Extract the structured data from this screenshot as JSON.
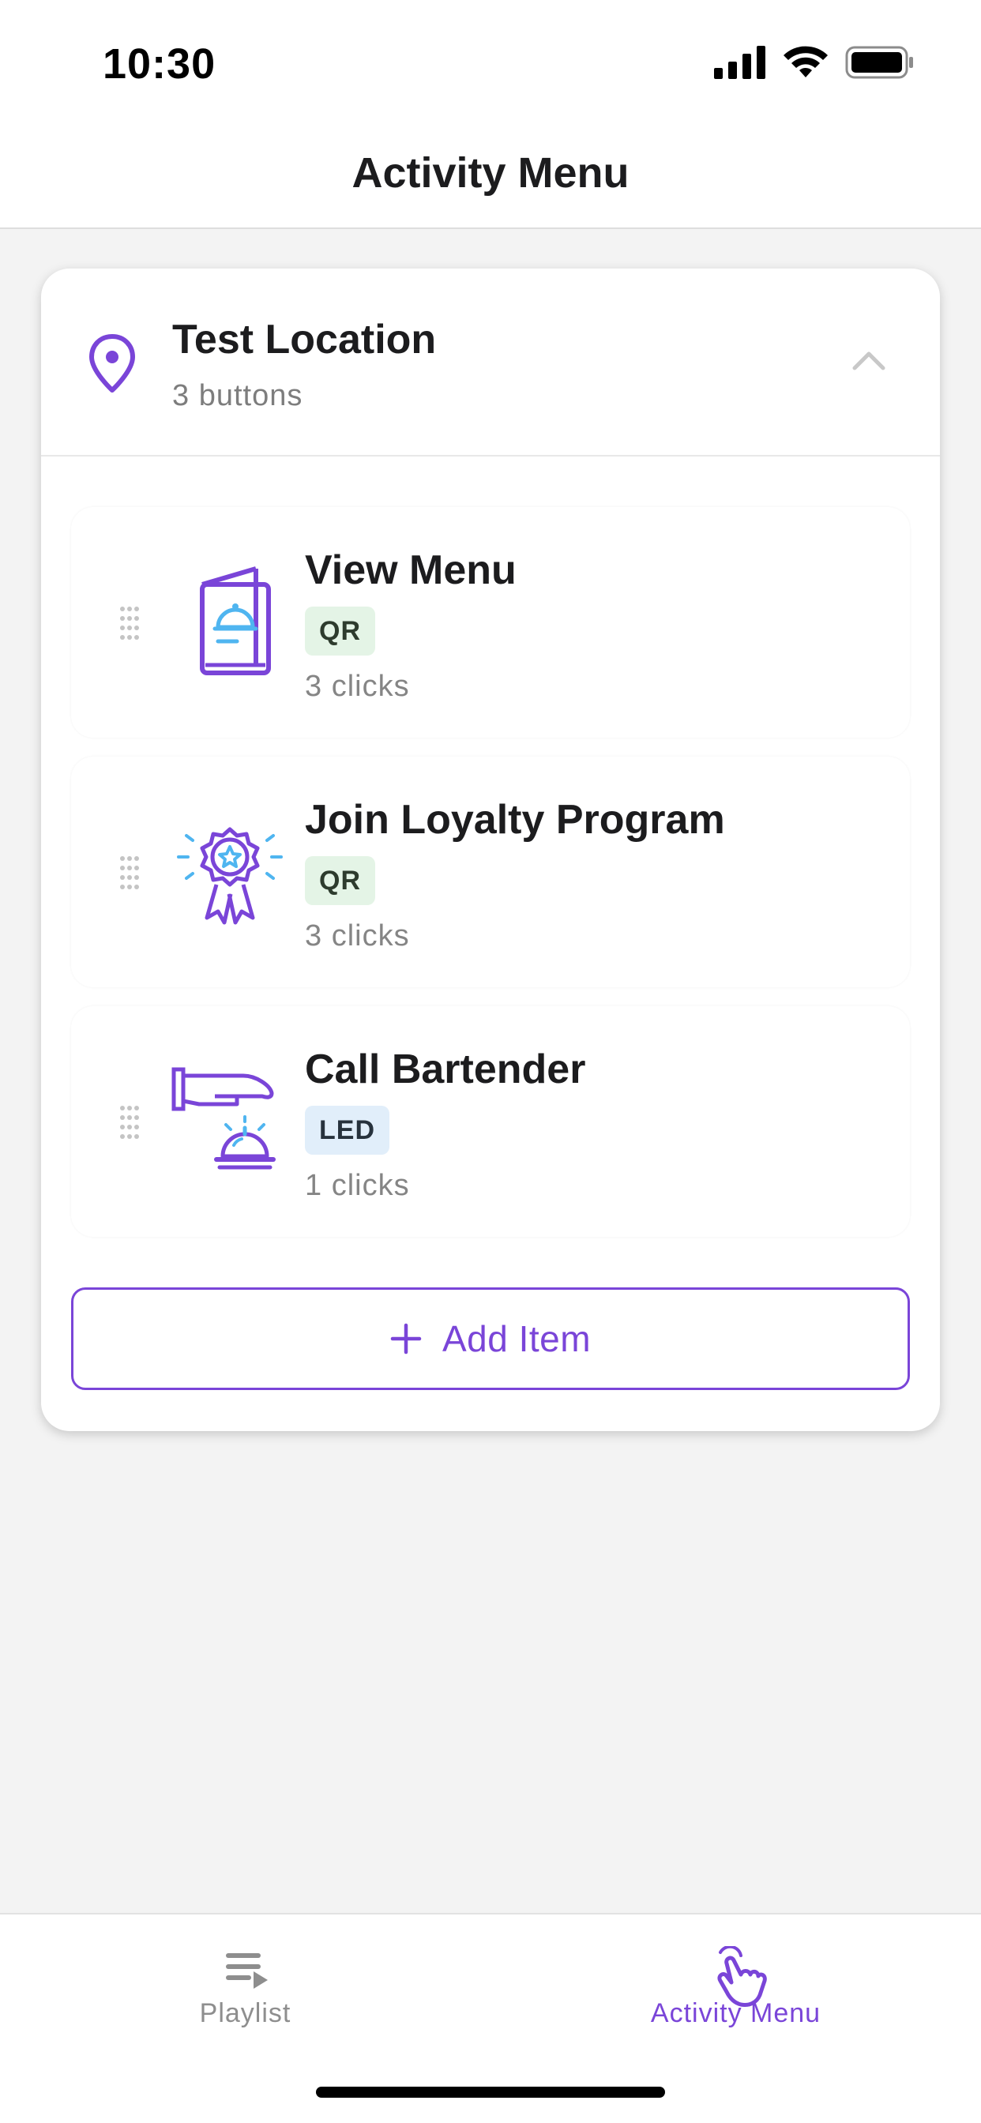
{
  "status_bar": {
    "time": "10:30"
  },
  "header": {
    "title": "Activity Menu"
  },
  "location": {
    "name": "Test Location",
    "subtitle": "3 buttons",
    "expanded": true
  },
  "items": [
    {
      "title": "View Menu",
      "badge": "QR",
      "clicks": "3 clicks",
      "icon": "menu-book-icon"
    },
    {
      "title": "Join Loyalty Program",
      "badge": "QR",
      "clicks": "3 clicks",
      "icon": "award-badge-icon"
    },
    {
      "title": "Call Bartender",
      "badge": "LED",
      "clicks": "1 clicks",
      "icon": "service-bell-icon"
    }
  ],
  "add_item": {
    "label": "Add Item"
  },
  "tab_bar": {
    "tabs": [
      {
        "label": "Playlist",
        "icon": "playlist-icon",
        "active": false
      },
      {
        "label": "Activity Menu",
        "icon": "tap-hand-icon",
        "active": true
      }
    ]
  },
  "colors": {
    "accent": "#7a45d8",
    "accent_light": "#4fb5f0",
    "qr_badge_bg": "#e4f4e6",
    "led_badge_bg": "#e1eefa"
  }
}
